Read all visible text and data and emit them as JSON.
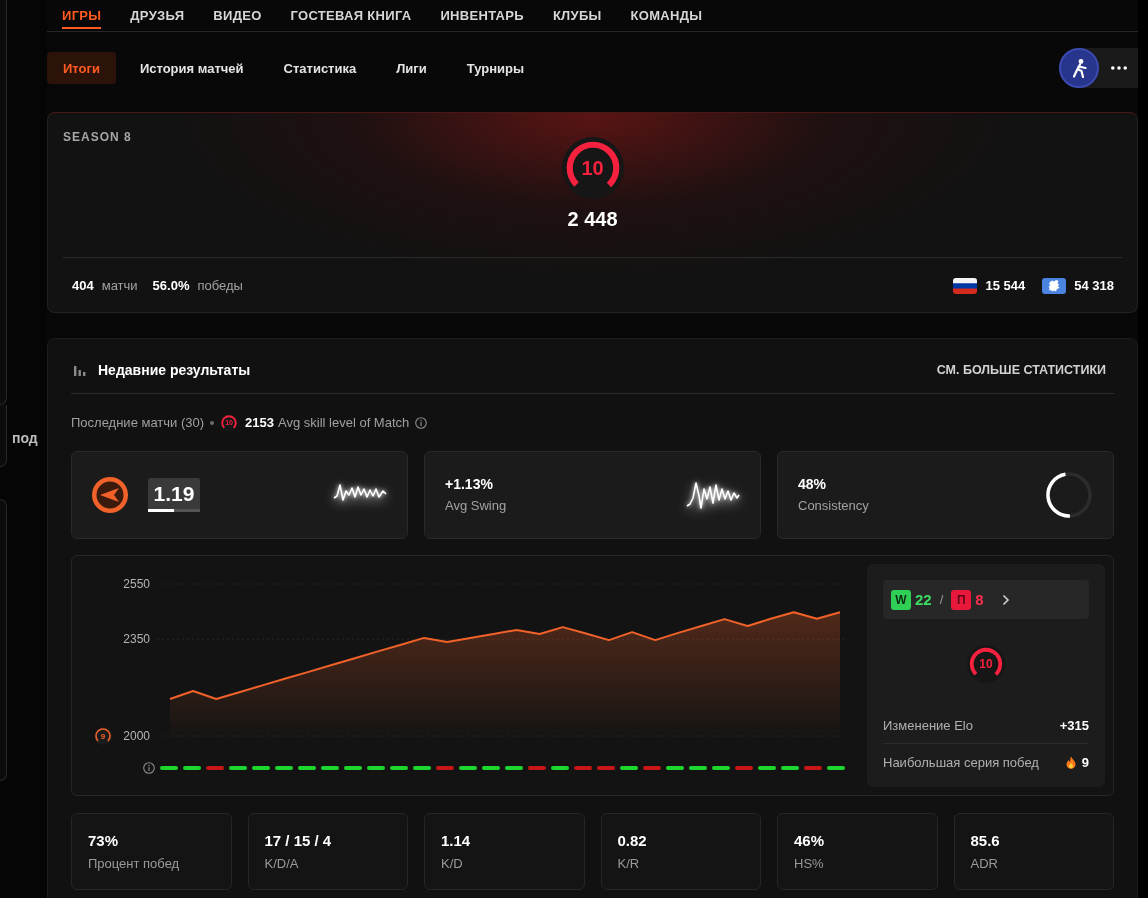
{
  "left_panel": {
    "text": "под"
  },
  "nav_tabs": [
    {
      "label": "ИГРЫ",
      "selected": true
    },
    {
      "label": "ДРУЗЬЯ",
      "selected": false
    },
    {
      "label": "ВИДЕО",
      "selected": false
    },
    {
      "label": "ГОСТЕВАЯ КНИГА",
      "selected": false
    },
    {
      "label": "ИНВЕНТАРЬ",
      "selected": false
    },
    {
      "label": "КЛУБЫ",
      "selected": false
    },
    {
      "label": "КОМАНДЫ",
      "selected": false
    }
  ],
  "sub_tabs": [
    {
      "label": "Итоги",
      "selected": true
    },
    {
      "label": "История матчей",
      "selected": false
    },
    {
      "label": "Статистика",
      "selected": false
    },
    {
      "label": "Лиги",
      "selected": false
    },
    {
      "label": "Турниры",
      "selected": false
    }
  ],
  "season": {
    "title": "SEASON 8",
    "skill_level": "10",
    "elo": "2 448",
    "matches": {
      "value": "404",
      "label": "матчи"
    },
    "winrate": {
      "value": "56.0%",
      "label": "победы"
    },
    "ranks": [
      {
        "kind": "country",
        "value": "15 544"
      },
      {
        "kind": "region",
        "value": "54 318"
      }
    ]
  },
  "recent": {
    "title": "Недавние результаты",
    "link": "СМ. БОЛЬШЕ СТАТИСТИКИ",
    "matches_label": "Последние матчи (30)",
    "avg_skill_level": "10",
    "avg_elo": "2153",
    "avg_label": "Avg skill level of Match",
    "stat_cards": [
      {
        "kind": "rating",
        "value": "1.19",
        "level": 0.5
      },
      {
        "kind": "sparkline",
        "value": "+1.13%",
        "label": "Avg Swing"
      },
      {
        "kind": "ring",
        "value": "48%",
        "label": "Consistency",
        "level": 0.48
      }
    ],
    "elo_chart": {
      "chart_data": {
        "type": "area",
        "ylim": [
          2000,
          2550
        ],
        "yticks": [
          2000,
          2350,
          2550
        ],
        "series": [
          {
            "color": "#f0622a",
            "values": [
              2134,
              2163,
              2134,
              2158,
              2183,
              2208,
              2232,
              2257,
              2281,
              2306,
              2330,
              2355,
              2340,
              2355,
              2369,
              2384,
              2369,
              2394,
              2371,
              2347,
              2376,
              2347,
              2373,
              2398,
              2423,
              2398,
              2424,
              2448,
              2424,
              2448
            ]
          }
        ]
      },
      "floor_level": "9",
      "results": [
        {
          "win": true
        },
        {
          "win": true
        },
        {
          "win": false
        },
        {
          "win": true
        },
        {
          "win": true
        },
        {
          "win": true
        },
        {
          "win": true
        },
        {
          "win": true
        },
        {
          "win": true
        },
        {
          "win": true
        },
        {
          "win": true
        },
        {
          "win": true
        },
        {
          "win": false
        },
        {
          "win": true
        },
        {
          "win": true
        },
        {
          "win": true
        },
        {
          "win": false
        },
        {
          "win": true
        },
        {
          "win": false
        },
        {
          "win": false
        },
        {
          "win": true
        },
        {
          "win": false
        },
        {
          "win": true
        },
        {
          "win": true
        },
        {
          "win": true
        },
        {
          "win": false
        },
        {
          "win": true
        },
        {
          "win": true
        },
        {
          "win": false
        },
        {
          "win": true
        }
      ]
    },
    "summary": {
      "win_badge": "W",
      "wins": "22",
      "separator": "/",
      "loss_badge": "П",
      "losses": "8",
      "skill_level": "10",
      "rows": [
        {
          "kind": "plain",
          "label": "Изменение Elo",
          "value": "+315"
        },
        {
          "kind": "streak",
          "label": "Наибольшая серия побед",
          "value": "9"
        }
      ]
    },
    "totals": [
      {
        "value": "73%",
        "label": "Процент побед"
      },
      {
        "value": "17 / 15 / 4",
        "label": "K/D/A"
      },
      {
        "value": "1.14",
        "label": "K/D"
      },
      {
        "value": "0.82",
        "label": "K/R"
      },
      {
        "value": "46%",
        "label": "HS%"
      },
      {
        "value": "85.6",
        "label": "ADR"
      }
    ]
  }
}
